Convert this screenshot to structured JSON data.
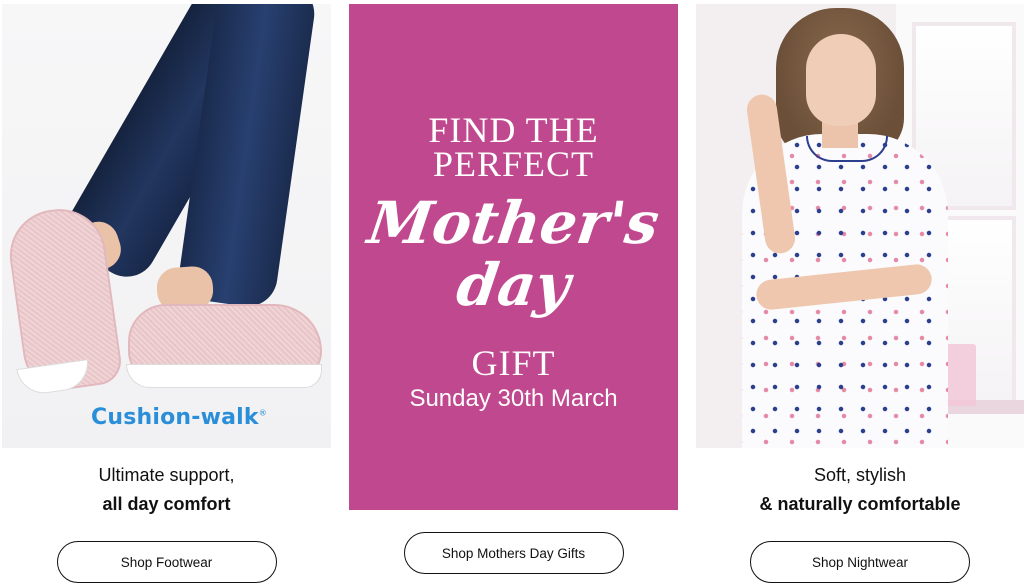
{
  "panels": [
    {
      "brand": "Cushion-walk",
      "brand_mark": "®",
      "caption_line1": "Ultimate support,",
      "caption_line2": "all day comfort",
      "button_label": "Shop Footwear"
    },
    {
      "promo_line1": "FIND THE",
      "promo_line2": "PERFECT",
      "promo_script1": "Mother's",
      "promo_script2": "day",
      "promo_gift": "GIFT",
      "promo_date": "Sunday 30th March",
      "promo_bg": "#c0488e",
      "button_label": "Shop Mothers Day Gifts"
    },
    {
      "caption_line1": "Soft, stylish",
      "caption_line2": "& naturally comfortable",
      "button_label": "Shop Nightwear"
    }
  ],
  "colors": {
    "brand_blue": "#2a8fd8",
    "promo_pink": "#c0488e",
    "text": "#111111"
  }
}
